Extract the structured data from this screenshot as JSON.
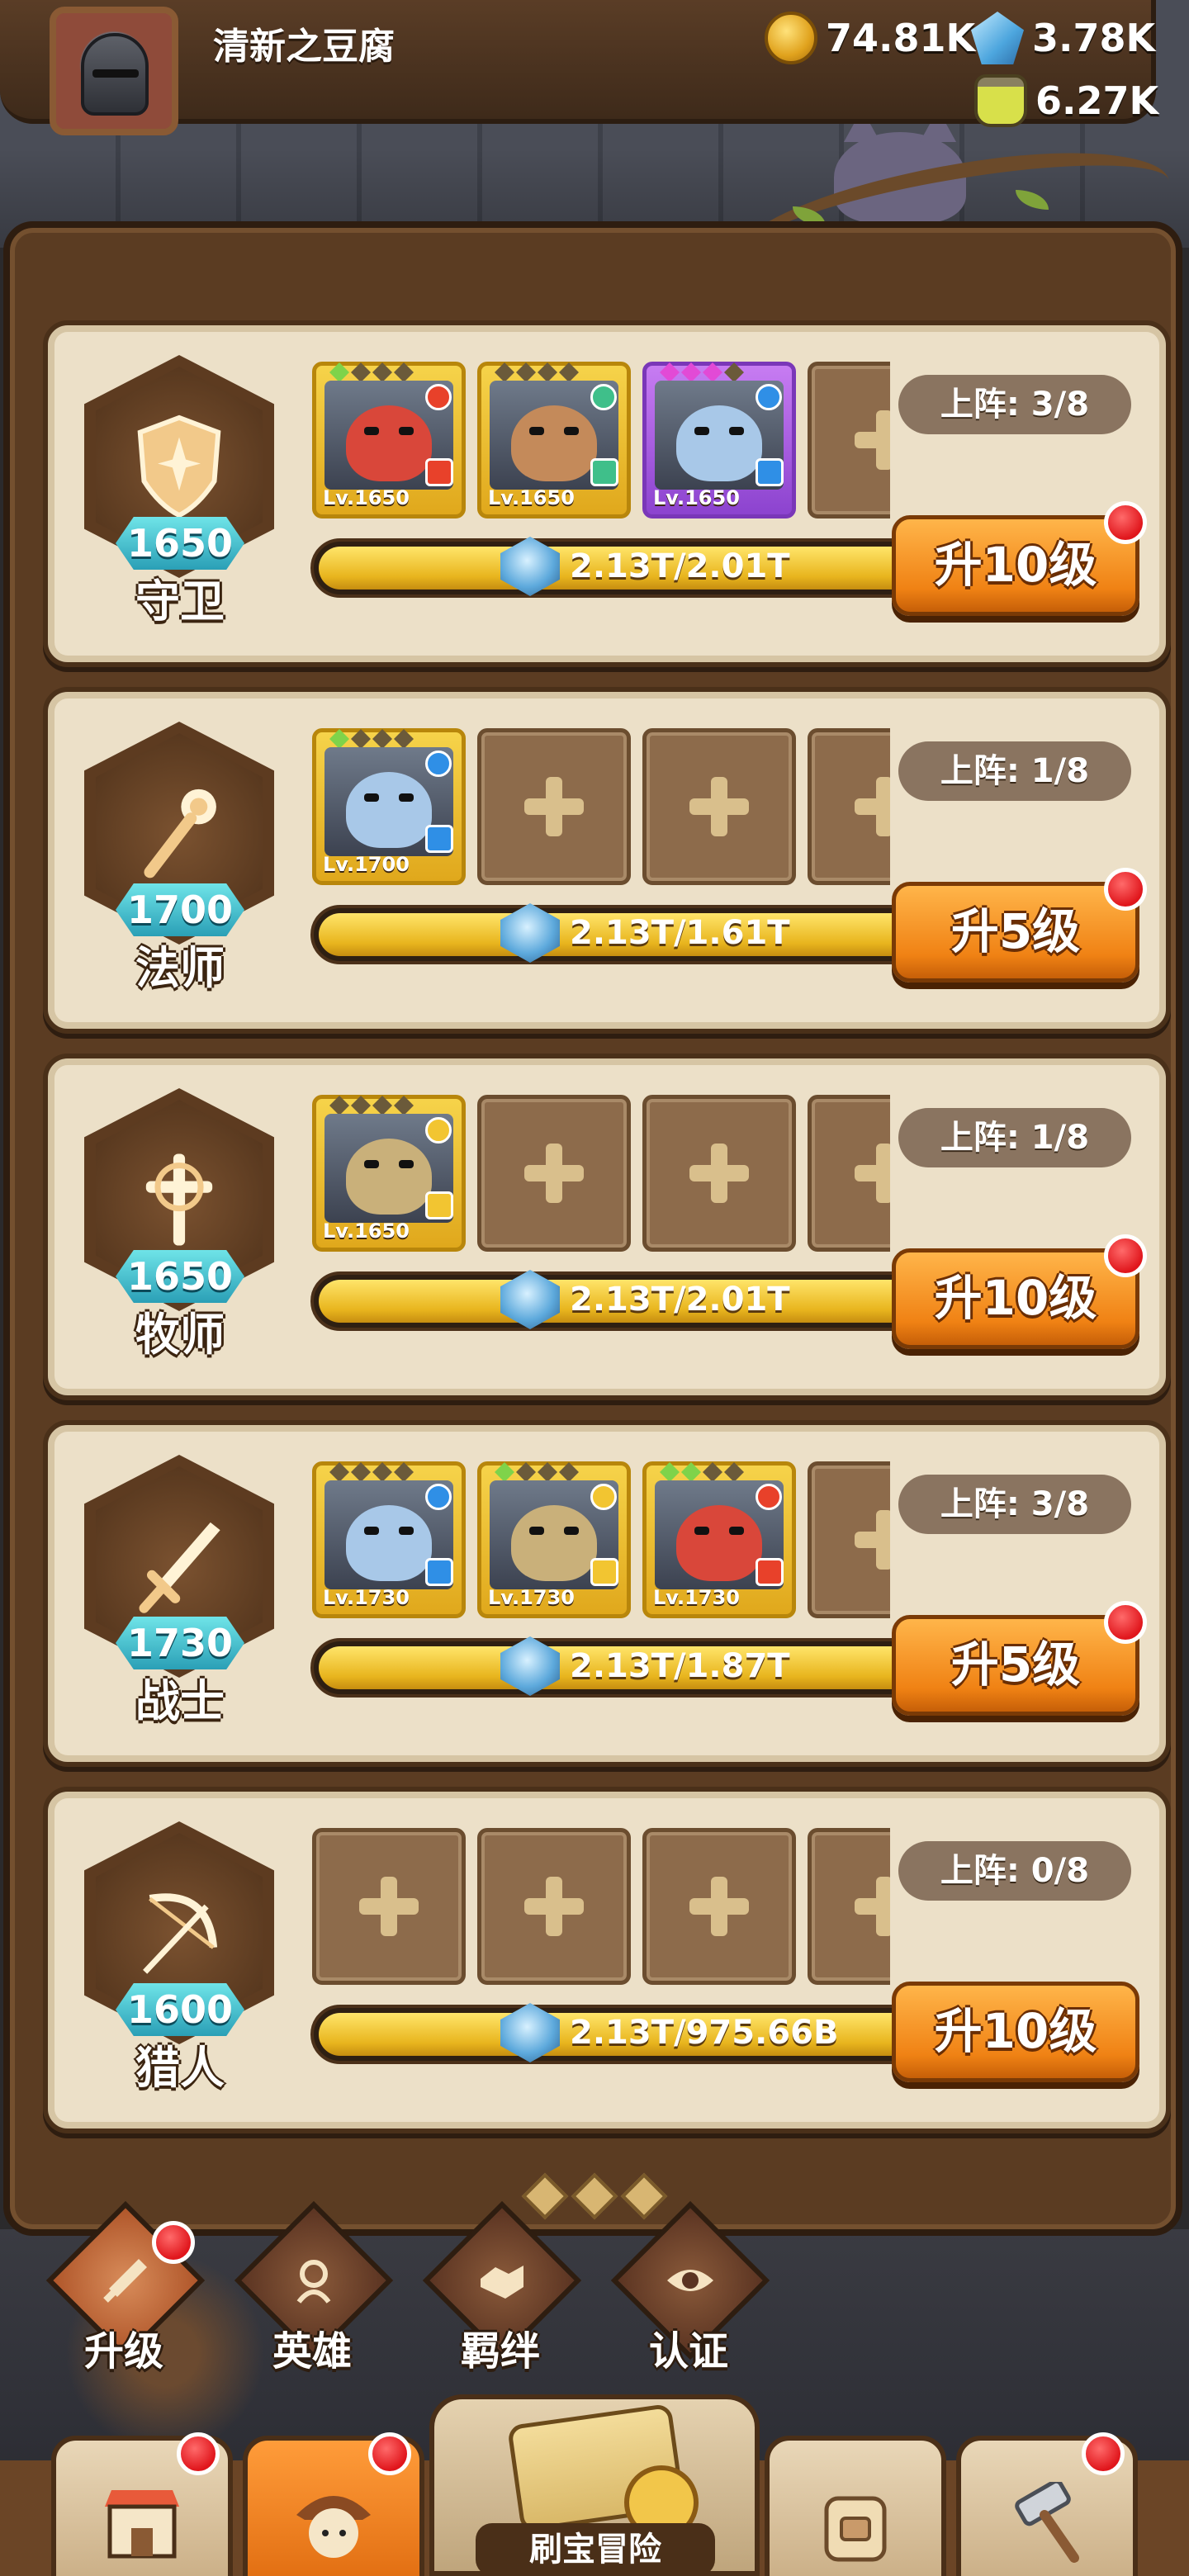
{
  "player": {
    "name": "清新之豆腐"
  },
  "resources": {
    "gold": "74.81K",
    "gems": "3.78K",
    "potion": "6.27K"
  },
  "classes": [
    {
      "name": "守卫",
      "level": "1650",
      "deploy": "上阵: 3/8",
      "progress_text": "2.13T/2.01T",
      "progress_fraction": 1.0,
      "upgrade_label": "升10级",
      "has_alert": true,
      "icon": "shield-icon",
      "heroes": [
        {
          "level": "Lv.1650",
          "element": "fire",
          "frame": "gold",
          "stars_on": 1,
          "star_color": "green"
        },
        {
          "level": "Lv.1650",
          "element": "wind",
          "frame": "gold",
          "stars_on": 0,
          "star_color": "green"
        },
        {
          "level": "Lv.1650",
          "element": "water",
          "frame": "purple",
          "stars_on": 3,
          "star_color": "pink"
        }
      ],
      "empty_slots": 1
    },
    {
      "name": "法师",
      "level": "1700",
      "deploy": "上阵: 1/8",
      "progress_text": "2.13T/1.61T",
      "progress_fraction": 1.0,
      "upgrade_label": "升5级",
      "has_alert": true,
      "icon": "staff-icon",
      "heroes": [
        {
          "level": "Lv.1700",
          "element": "water",
          "frame": "gold",
          "stars_on": 1,
          "star_color": "green"
        }
      ],
      "empty_slots": 3
    },
    {
      "name": "牧师",
      "level": "1650",
      "deploy": "上阵: 1/8",
      "progress_text": "2.13T/2.01T",
      "progress_fraction": 1.0,
      "upgrade_label": "升10级",
      "has_alert": true,
      "icon": "holy-cross-icon",
      "heroes": [
        {
          "level": "Lv.1650",
          "element": "light",
          "frame": "gold",
          "stars_on": 0,
          "star_color": "green"
        }
      ],
      "empty_slots": 3
    },
    {
      "name": "战士",
      "level": "1730",
      "deploy": "上阵: 3/8",
      "progress_text": "2.13T/1.87T",
      "progress_fraction": 1.0,
      "upgrade_label": "升5级",
      "has_alert": true,
      "icon": "sword-icon",
      "heroes": [
        {
          "level": "Lv.1730",
          "element": "water",
          "frame": "gold",
          "stars_on": 0,
          "star_color": "green"
        },
        {
          "level": "Lv.1730",
          "element": "light",
          "frame": "gold",
          "stars_on": 1,
          "star_color": "green"
        },
        {
          "level": "Lv.1730",
          "element": "fire",
          "frame": "gold",
          "stars_on": 2,
          "star_color": "green"
        }
      ],
      "empty_slots": 1
    },
    {
      "name": "猎人",
      "level": "1600",
      "deploy": "上阵: 0/8",
      "progress_text": "2.13T/975.66B",
      "progress_fraction": 1.0,
      "upgrade_label": "升10级",
      "has_alert": false,
      "icon": "bow-icon",
      "heroes": [],
      "empty_slots": 4
    }
  ],
  "subnav": [
    {
      "label": "升级",
      "icon": "sword-upgrade-icon",
      "active": true,
      "alert": true
    },
    {
      "label": "英雄",
      "icon": "hero-rune-icon",
      "active": false,
      "alert": false
    },
    {
      "label": "羁绊",
      "icon": "handshake-icon",
      "active": false,
      "alert": false
    },
    {
      "label": "认证",
      "icon": "eye-icon",
      "active": false,
      "alert": false
    }
  ],
  "bottom_nav": {
    "center_label": "刷宝冒险",
    "tabs": [
      {
        "name": "shop",
        "icon": "shop-icon",
        "alert": true,
        "active": false
      },
      {
        "name": "heroes",
        "icon": "hero-portrait-icon",
        "alert": true,
        "active": true
      },
      {
        "name": "bag",
        "icon": "backpack-icon",
        "alert": false,
        "active": false
      },
      {
        "name": "forge",
        "icon": "hammer-icon",
        "alert": true,
        "active": false
      }
    ]
  },
  "colors": {
    "fire": "#e8412a",
    "water": "#2f8fe6",
    "wind": "#3fbf8a",
    "light": "#f2c531",
    "accent_orange": "#f08214",
    "badge_teal": "#2a9fb6"
  }
}
